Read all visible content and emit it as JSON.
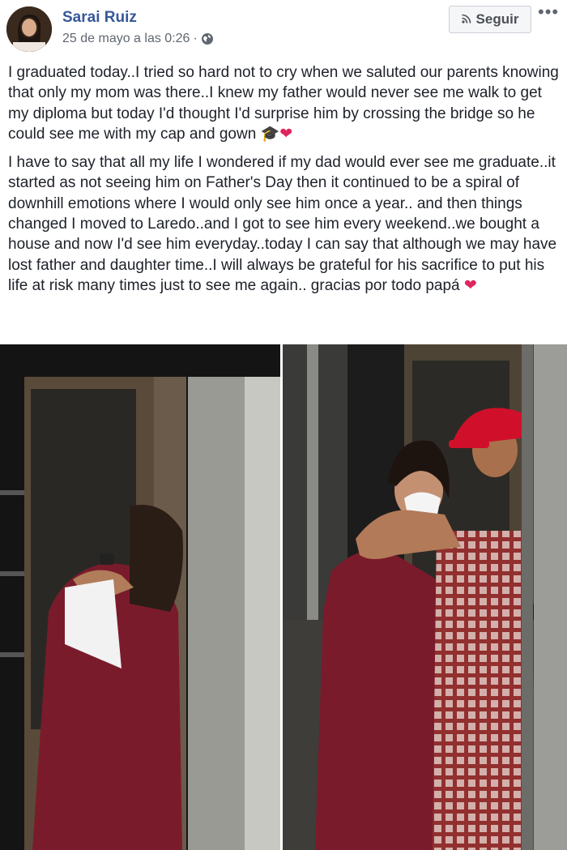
{
  "post": {
    "author": "Sarai Ruiz",
    "timestamp": "25 de mayo a las 0:26",
    "separator": "·",
    "follow_label": "Seguir",
    "more_label": "•••",
    "paragraph1": "I graduated today..I tried so hard not to cry when we saluted our parents knowing that only my mom was there..I knew my father would never see me walk to get my diploma but today I'd thought I'd surprise him by crossing the bridge so he could see me with my cap and gown",
    "paragraph2": "I have to say that all my life I wondered if my dad would ever see me graduate..it started as not seeing him on Father's Day then it continued to be a spiral of downhill emotions where I would only see him once a year.. and then things changed I moved to Laredo..and I got to see him every weekend..we bought a house and now I'd see him everyday..today I can say that although we may have lost father and daughter time..I will always be grateful for his sacrifice to put his life at risk many times just to see me again.. gracias por todo papá",
    "emoji_cap": "🎓",
    "emoji_heart": "❤"
  },
  "icons": {
    "globe": "globe-icon",
    "rss": "rss-icon",
    "more": "more-icon",
    "cap": "graduation-cap-icon",
    "heart": "heart-icon"
  },
  "colors": {
    "author": "#365899",
    "meta": "#606770",
    "gown": "#7a1b2b",
    "cap": "#d0102a"
  }
}
